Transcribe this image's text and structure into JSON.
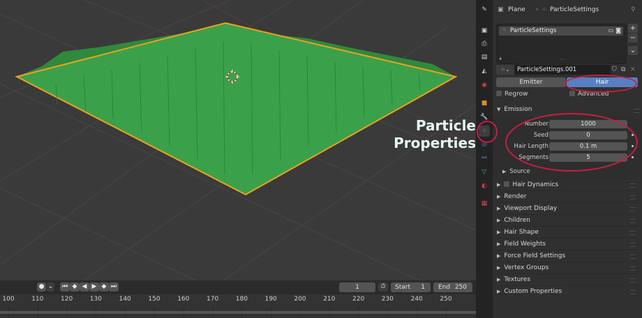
{
  "annotation": {
    "line1": "Particle",
    "line2": "Properties"
  },
  "colors": {
    "accent": "#5680c2",
    "annotation_red": "#c81d43",
    "plane_fill": "#3aa14a",
    "plane_outline": "#f0a020",
    "annotation_text": "#e6f6f6"
  },
  "timeline": {
    "current_frame": "1",
    "start_label": "Start",
    "start_value": "1",
    "end_label": "End",
    "end_value": "250",
    "ruler_labels": [
      "100",
      "110",
      "120",
      "130",
      "140",
      "150",
      "160",
      "170",
      "180",
      "190",
      "200",
      "210",
      "220",
      "230",
      "240",
      "250"
    ]
  },
  "properties": {
    "breadcrumb": {
      "object": "Plane",
      "settings": "ParticleSettings"
    },
    "particle_system": "ParticleSettings",
    "datablock": "ParticleSettings.001",
    "type_options": {
      "emitter": "Emitter",
      "hair": "Hair"
    },
    "regrow_label": "Regrow",
    "advanced_label": "Advanced",
    "emission": {
      "title": "Emission",
      "number_label": "Number",
      "number_value": "1000",
      "seed_label": "Seed",
      "seed_value": "0",
      "hair_length_label": "Hair Length",
      "hair_length_value": "0.1 m",
      "segments_label": "Segments",
      "segments_value": "5",
      "source_label": "Source"
    },
    "hair_dynamics": "Hair Dynamics",
    "sections": [
      "Render",
      "Viewport Display",
      "Children",
      "Hair Shape",
      "Field Weights",
      "Force Field Settings",
      "Vertex Groups",
      "Textures",
      "Custom Properties"
    ]
  }
}
